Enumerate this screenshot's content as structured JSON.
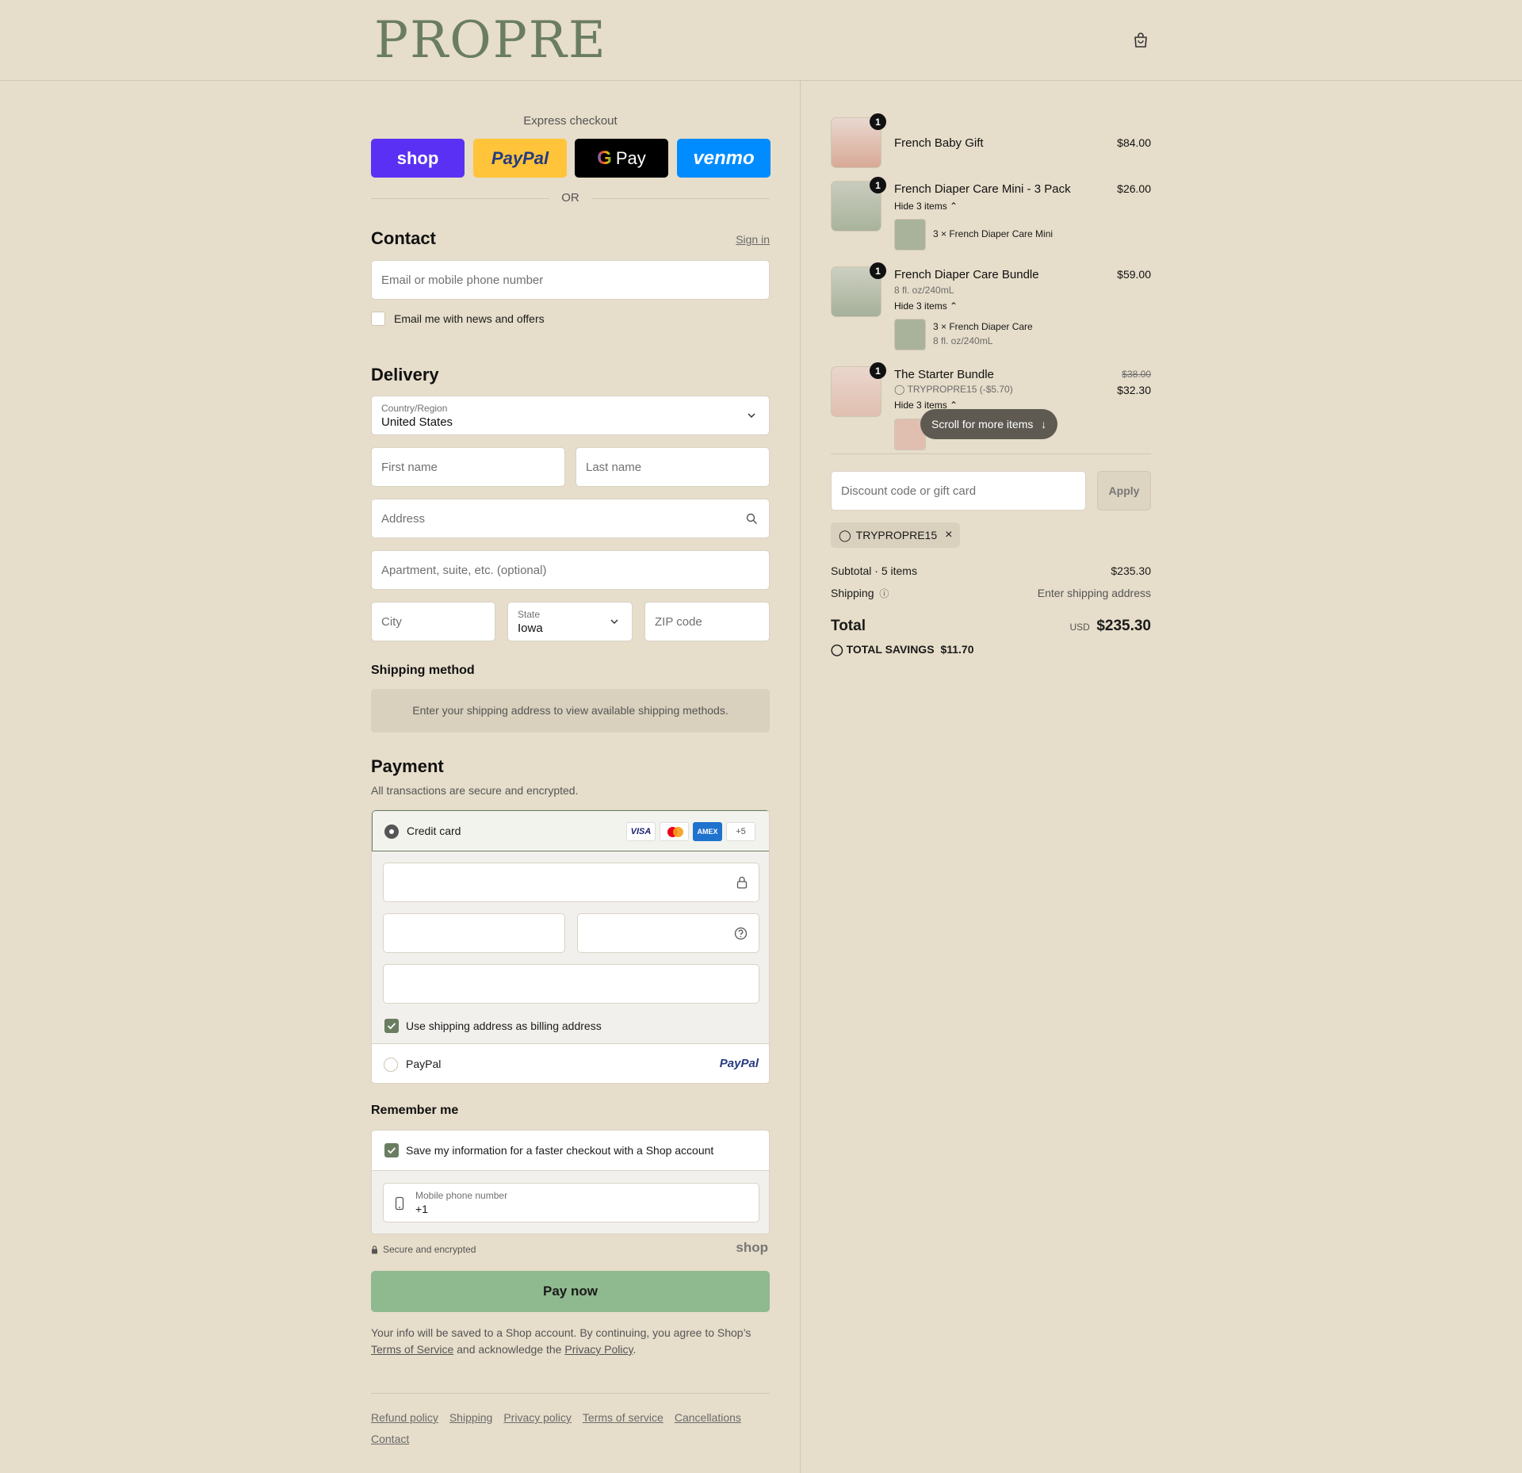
{
  "brand": {
    "logo": "PROPRE"
  },
  "express": {
    "label": "Express checkout",
    "shop": "shop",
    "paypal": "PayPal",
    "gpay": "Pay",
    "venmo": "venmo",
    "or": "OR"
  },
  "contact": {
    "title": "Contact",
    "sign_in": "Sign in",
    "email_placeholder": "Email or mobile phone number",
    "news_label": "Email me with news and offers"
  },
  "delivery": {
    "title": "Delivery",
    "country_label": "Country/Region",
    "country_value": "United States",
    "first_name": "First name",
    "last_name": "Last name",
    "address": "Address",
    "apartment": "Apartment, suite, etc. (optional)",
    "city": "City",
    "state_label": "State",
    "state_value": "Iowa",
    "zip": "ZIP code"
  },
  "shipping_method": {
    "title": "Shipping method",
    "note": "Enter your shipping address to view available shipping methods."
  },
  "payment": {
    "title": "Payment",
    "subtitle": "All transactions are secure and encrypted.",
    "credit_card": "Credit card",
    "card_logos": [
      "VISA",
      "",
      "AMEX",
      "+5"
    ],
    "billing_same": "Use shipping address as billing address",
    "paypal": "PayPal",
    "paypal_logo": "PayPal"
  },
  "remember": {
    "title": "Remember me",
    "save_label": "Save my information for a faster checkout with a Shop account",
    "phone_label": "Mobile phone number",
    "phone_value": "+1",
    "secure": "Secure and encrypted",
    "shop_logo": "shop"
  },
  "pay_now": "Pay now",
  "legal": {
    "text1": "Your info will be saved to a Shop account. By continuing, you agree to Shop’s",
    "terms": "Terms of Service",
    "text2": "and acknowledge the",
    "privacy": "Privacy Policy",
    "end": "."
  },
  "footer_links": [
    "Refund policy",
    "Shipping",
    "Privacy policy",
    "Terms of service",
    "Cancellations",
    "Contact"
  ],
  "cart": {
    "items": [
      {
        "qty": "1",
        "name": "French Baby Gift",
        "price": "$84.00"
      },
      {
        "qty": "1",
        "name": "French Diaper Care Mini - 3 Pack",
        "price": "$26.00",
        "hide": "Hide 3 items",
        "sub_item": "3 × French Diaper Care Mini"
      },
      {
        "qty": "1",
        "name": "French Diaper Care Bundle",
        "price": "$59.00",
        "variant": "8 fl. oz/240mL",
        "hide": "Hide 3 items",
        "sub_item": "3 × French Diaper Care",
        "sub_variant": "8 fl. oz/240mL"
      },
      {
        "qty": "1",
        "name": "The Starter Bundle",
        "orig_price": "$38.00",
        "price": "$32.30",
        "discount": "TRYPROPRE15 (-$5.70)",
        "hide": "Hide 3 items"
      }
    ],
    "scroll_hint": "Scroll for more items",
    "discount_placeholder": "Discount code or gift card",
    "apply": "Apply",
    "code": "TRYPROPRE15",
    "subtotal_label": "Subtotal · 5 items",
    "subtotal": "$235.30",
    "shipping_label": "Shipping",
    "shipping_value": "Enter shipping address",
    "total_label": "Total",
    "currency": "USD",
    "total": "$235.30",
    "savings_label": "TOTAL SAVINGS",
    "savings": "$11.70"
  },
  "colors": {
    "accent": "#6a7d60",
    "pay_button": "#8fb98e",
    "background": "#e6ddca"
  }
}
